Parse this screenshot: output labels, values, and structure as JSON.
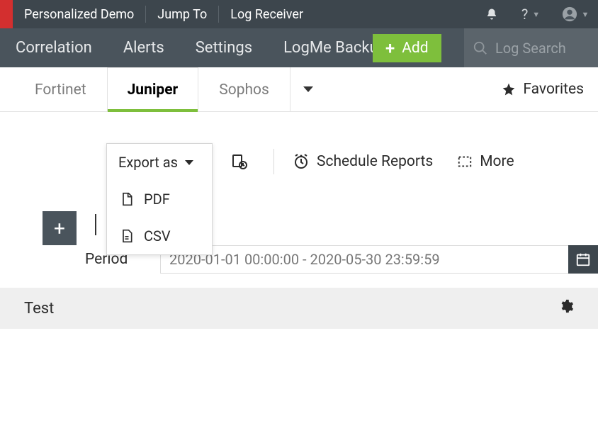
{
  "top": {
    "demo": "Personalized Demo",
    "jump": "Jump To",
    "logrecv": "Log Receiver",
    "help": "?"
  },
  "nav": {
    "items": [
      "Correlation",
      "Alerts",
      "Settings",
      "LogMe Backup"
    ],
    "add": "Add",
    "search_placeholder": "Log Search"
  },
  "tabs": {
    "items": [
      "Fortinet",
      "Juniper",
      "Sophos"
    ],
    "active_index": 1,
    "favorites": "Favorites"
  },
  "toolbar": {
    "export_label": "Export as",
    "export_options": {
      "pdf": "PDF",
      "csv": "CSV"
    },
    "schedule": "Schedule Reports",
    "more": "More"
  },
  "period": {
    "label": "Period",
    "value": "2020-01-01 00:00:00 - 2020-05-30 23:59:59"
  },
  "panel": {
    "title": "Test"
  }
}
